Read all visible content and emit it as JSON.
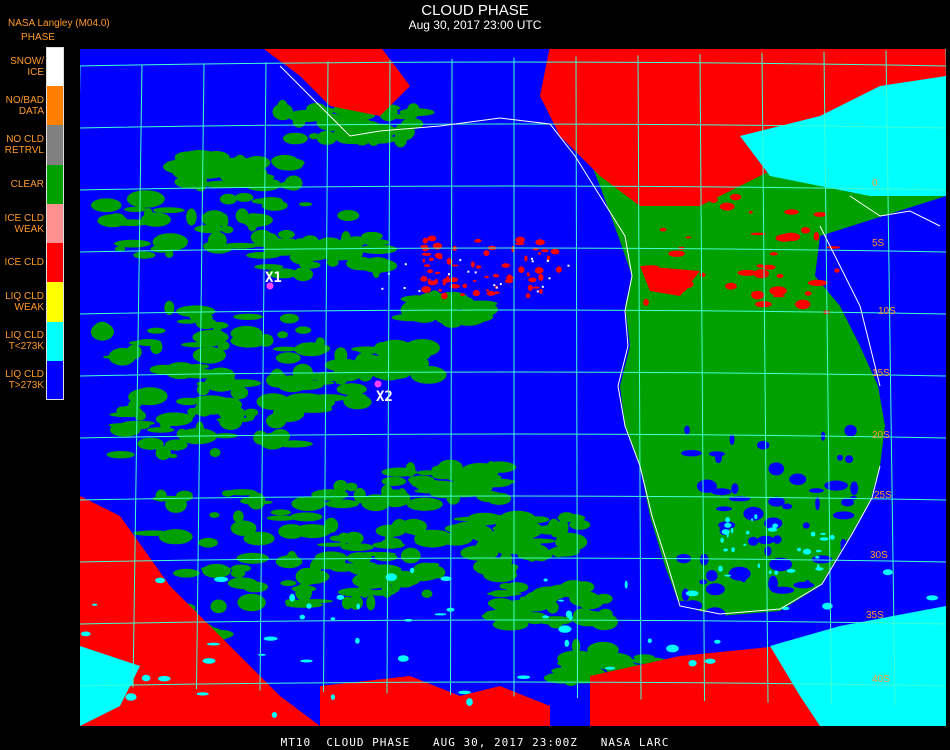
{
  "header": {
    "title": "CLOUD PHASE",
    "date": "Aug 30, 2017 23:00 UTC"
  },
  "producer": "NASA Langley (M04.0)",
  "legend": {
    "title": "PHASE",
    "items": [
      {
        "label": "SNOW/\nICE",
        "color": "#ffffff"
      },
      {
        "label": "NO/BAD\nDATA",
        "color": "#ff8000"
      },
      {
        "label": "NO CLD\nRETRVL",
        "color": "#808080"
      },
      {
        "label": "CLEAR",
        "color": "#00a000"
      },
      {
        "label": "ICE CLD\nWEAK",
        "color": "#ff9090"
      },
      {
        "label": "ICE CLD",
        "color": "#ff0000"
      },
      {
        "label": "LIQ CLD\nWEAK",
        "color": "#ffff00"
      },
      {
        "label": "LIQ CLD\nT<273K",
        "color": "#00ffff"
      },
      {
        "label": "LIQ CLD\nT>273K",
        "color": "#0000ff"
      }
    ]
  },
  "map": {
    "grid_color": "#40ffd0",
    "coast_color": "#ffffff",
    "markers": [
      {
        "label": "X1",
        "color": "#ff40ff"
      },
      {
        "label": "X2",
        "color": "#ff40ff"
      }
    ],
    "lat_labels": [
      "0",
      "5S",
      "10S",
      "15S",
      "20S",
      "25S",
      "30S",
      "35S",
      "40S"
    ]
  },
  "footer": "MT10  CLOUD PHASE   AUG 30, 2017 23:00Z   NASA LARC"
}
